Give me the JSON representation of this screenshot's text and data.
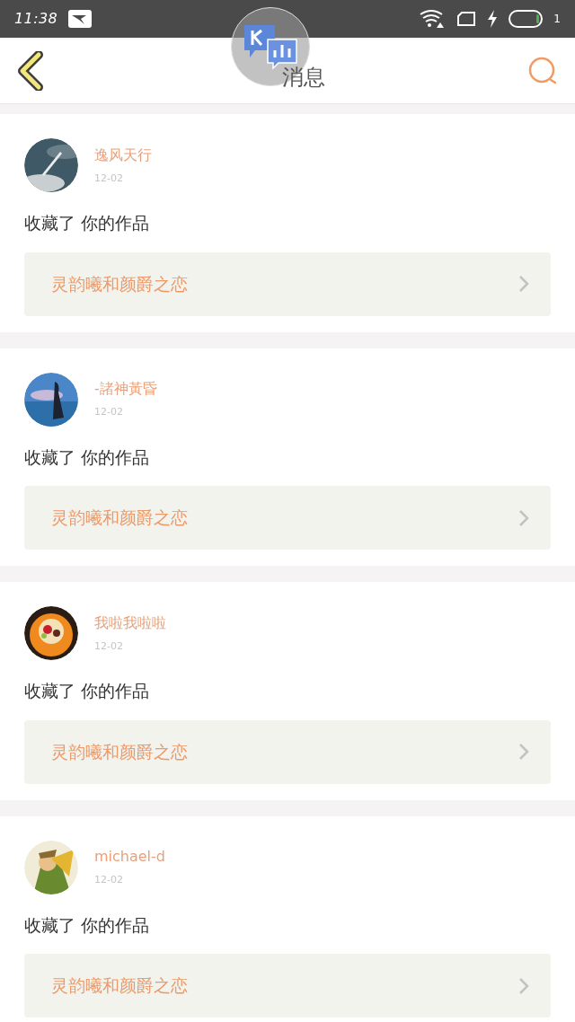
{
  "status_bar": {
    "time": "11:38",
    "battery_text": "1"
  },
  "header": {
    "title": "消息"
  },
  "messages": [
    {
      "user": "逸风天行",
      "date": "12-02",
      "action": "收藏了 你的作品",
      "work": "灵韵曦和颜爵之恋"
    },
    {
      "user": "-諸神黃昏",
      "date": "12-02",
      "action": "收藏了 你的作品",
      "work": "灵韵曦和颜爵之恋"
    },
    {
      "user": "我啦我啦啦",
      "date": "12-02",
      "action": "收藏了 你的作品",
      "work": "灵韵曦和颜爵之恋"
    },
    {
      "user": "michael-d",
      "date": "12-02",
      "action": "收藏了 你的作品",
      "work": "灵韵曦和颜爵之恋"
    }
  ]
}
